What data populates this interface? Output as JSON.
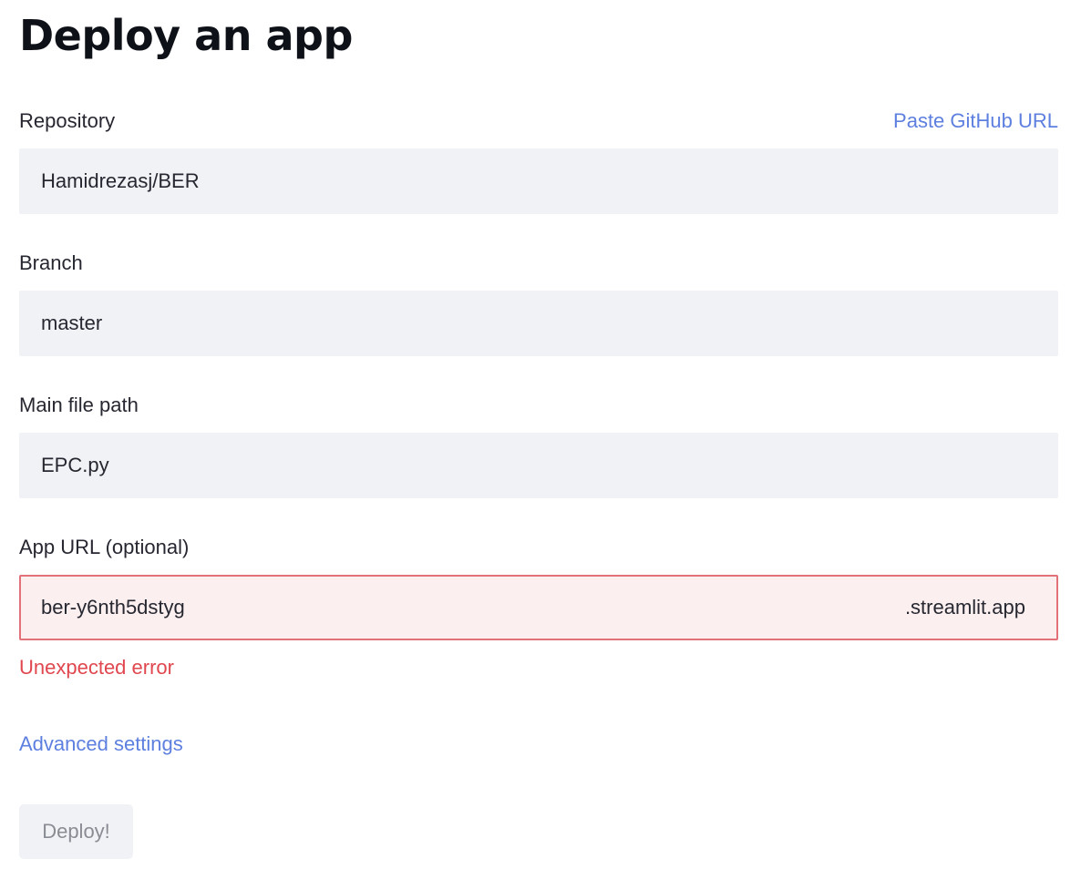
{
  "page": {
    "title": "Deploy an app"
  },
  "repository": {
    "label": "Repository",
    "paste_link": "Paste GitHub URL",
    "value": "Hamidrezasj/BER"
  },
  "branch": {
    "label": "Branch",
    "value": "master"
  },
  "main_file": {
    "label": "Main file path",
    "value": "EPC.py"
  },
  "app_url": {
    "label": "App URL (optional)",
    "value": "ber-y6nth5dstyg",
    "suffix": ".streamlit.app",
    "error": "Unexpected error"
  },
  "advanced_settings": "Advanced settings",
  "deploy_button": "Deploy!",
  "colors": {
    "link": "#5d7fdf",
    "error_text": "#e0474f",
    "error_border": "#e2717a",
    "error_background": "#fcefef",
    "field_background": "#f0f2f6"
  }
}
